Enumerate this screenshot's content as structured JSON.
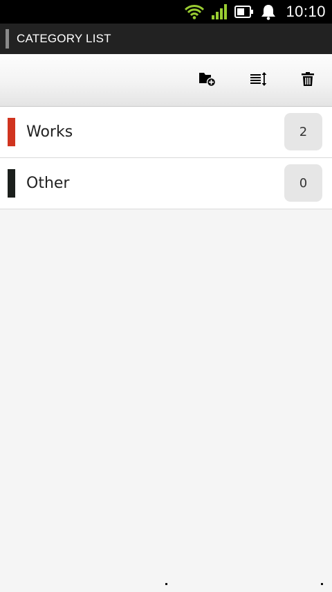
{
  "status_bar": {
    "time": "10:10",
    "icons": [
      "wifi-icon",
      "signal-icon",
      "battery-icon",
      "notification-bell-icon"
    ]
  },
  "title_bar": {
    "title": "CATEGORY LIST"
  },
  "toolbar": {
    "actions": [
      "add-category-icon",
      "sort-icon",
      "delete-icon"
    ]
  },
  "categories": [
    {
      "name": "Works",
      "count": "2",
      "color": "#d0341f"
    },
    {
      "name": "Other",
      "count": "0",
      "color": "#1b1f1c"
    }
  ],
  "colors": {
    "wifi_signal": "#9acd32",
    "title_bar": "#222222",
    "title_accent": "#8a8a8a"
  }
}
